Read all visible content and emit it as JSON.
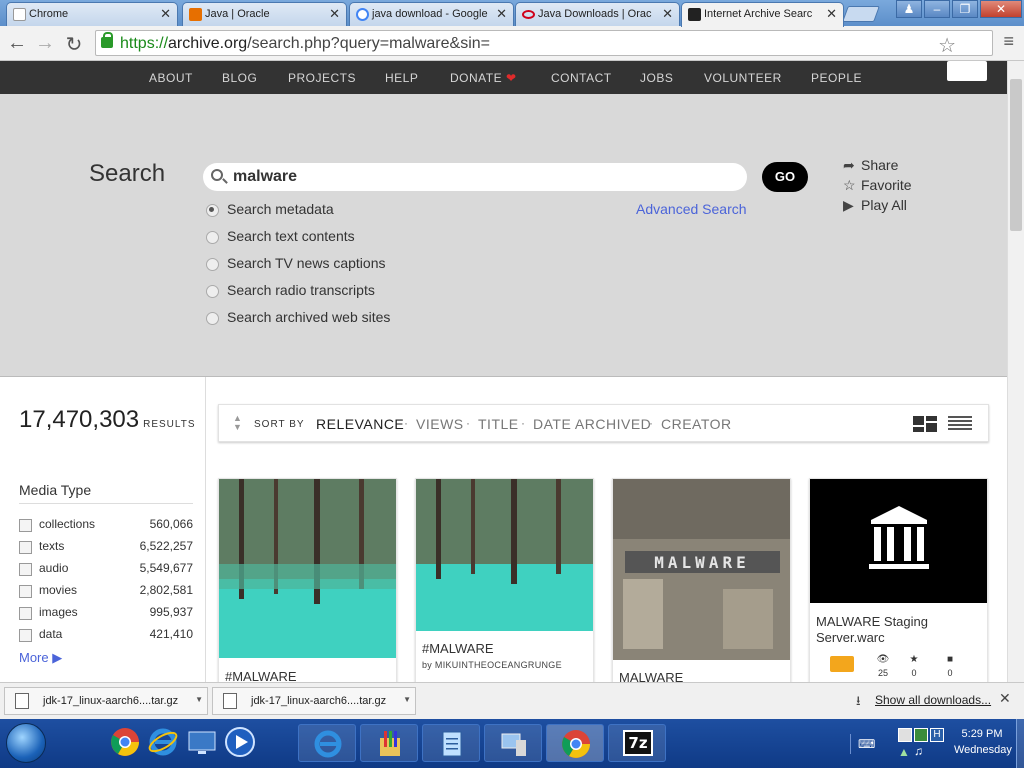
{
  "browser": {
    "tabs": [
      {
        "title": "Chrome",
        "favicon": "chrome-doc-icon"
      },
      {
        "title": "Java | Oracle",
        "favicon": "java-icon"
      },
      {
        "title": "java download - Google",
        "favicon": "google-icon"
      },
      {
        "title": "Java Downloads | Orac",
        "favicon": "oracle-icon"
      },
      {
        "title": "Internet Archive Searc",
        "favicon": "archive-icon"
      }
    ],
    "url_scheme": "https://",
    "url_host": "archive.org",
    "url_path": "/search.php?query=malware&sin=",
    "close_glyph": "✕"
  },
  "ia_nav": [
    "ABOUT",
    "BLOG",
    "PROJECTS",
    "HELP",
    "DONATE",
    "CONTACT",
    "JOBS",
    "VOLUNTEER",
    "PEOPLE"
  ],
  "search": {
    "title": "Search",
    "query": "malware",
    "go_label": "GO",
    "advanced_label": "Advanced Search",
    "options": [
      "Search metadata",
      "Search text contents",
      "Search TV news captions",
      "Search radio transcripts",
      "Search archived web sites"
    ],
    "actions": [
      "Share",
      "Favorite",
      "Play All"
    ]
  },
  "results": {
    "count": "17,470,303",
    "count_label": "RESULTS",
    "sort_by_label": "SORT BY",
    "sort_options": [
      "RELEVANCE",
      "VIEWS",
      "TITLE",
      "DATE ARCHIVED",
      "CREATOR"
    ],
    "media_type_title": "Media Type",
    "facets": [
      {
        "label": "collections",
        "count": "560,066"
      },
      {
        "label": "texts",
        "count": "6,522,257"
      },
      {
        "label": "audio",
        "count": "5,549,677"
      },
      {
        "label": "movies",
        "count": "2,802,581"
      },
      {
        "label": "images",
        "count": "995,937"
      },
      {
        "label": "data",
        "count": "421,410"
      }
    ],
    "more_label": "More",
    "cards": [
      {
        "title": "#MALWARE",
        "by": ""
      },
      {
        "title": "#MALWARE",
        "by": "by MIKUINTHEOCEANGRUNGE"
      },
      {
        "title": "MALWARE",
        "by": ""
      },
      {
        "title": "MALWARE Staging Server.warc",
        "by": "",
        "views": "25",
        "favs": "0",
        "reviews": "0"
      }
    ],
    "thumb_text": "MALWARE"
  },
  "downloads": {
    "items": [
      "jdk-17_linux-aarch6....tar.gz",
      "jdk-17_linux-aarch6....tar.gz"
    ],
    "show_all": "Show all downloads...",
    "close_glyph": "✕"
  },
  "taskbar": {
    "time": "5:29 PM",
    "day": "Wednesday",
    "pinned": [
      "chrome-icon",
      "internet-explorer-icon",
      "desktop-icon",
      "media-player-icon",
      "internet-explorer-icon",
      "paint-icon",
      "notepad-icon",
      "computer-icon",
      "chrome-icon",
      "7zip-icon"
    ],
    "label_7z": "7z"
  },
  "colors": {
    "link": "#4b64d9",
    "nav_bg": "#333333",
    "panel_bg": "#d9d9d9",
    "donate_heart": "#e02b2b"
  }
}
